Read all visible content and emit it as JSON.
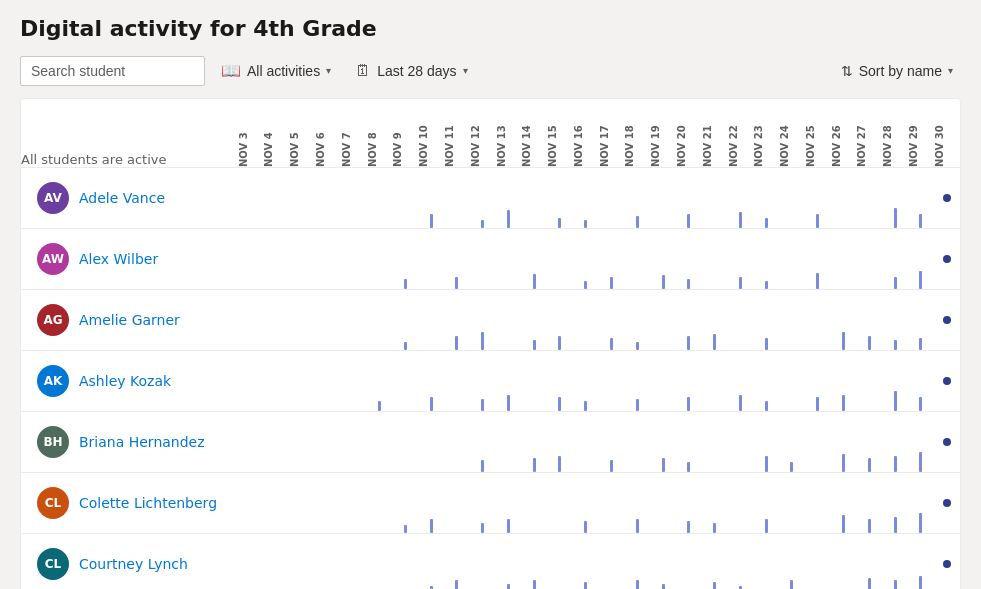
{
  "page": {
    "title": "Digital activity for 4th Grade"
  },
  "toolbar": {
    "search_placeholder": "Search student",
    "activities_label": "All activities",
    "date_range_label": "Last 28 days",
    "sort_label": "Sort by name"
  },
  "table": {
    "header_label": "All students are active",
    "dates": [
      "NOV 3",
      "NOV 4",
      "NOV 5",
      "NOV 6",
      "NOV 7",
      "NOV 8",
      "NOV 9",
      "NOV 10",
      "NOV 11",
      "NOV 12",
      "NOV 13",
      "NOV 14",
      "NOV 15",
      "NOV 16",
      "NOV 17",
      "NOV 18",
      "NOV 19",
      "NOV 20",
      "NOV 21",
      "NOV 22",
      "NOV 23",
      "NOV 24",
      "NOV 25",
      "NOV 26",
      "NOV 27",
      "NOV 28",
      "NOV 29",
      "NOV 30"
    ],
    "students": [
      {
        "initials": "AV",
        "name": "Adele Vance",
        "color": "#6b3fa0"
      },
      {
        "initials": "AW",
        "name": "Alex Wilber",
        "color": "#b0399e"
      },
      {
        "initials": "AG",
        "name": "Amelie Garner",
        "color": "#a4262c"
      },
      {
        "initials": "AK",
        "name": "Ashley Kozak",
        "color": "#0078d4"
      },
      {
        "initials": "BH",
        "name": "Briana Hernandez",
        "color": "#4f6b5e"
      },
      {
        "initials": "CL",
        "name": "Colette Lichtenberg",
        "color": "#ca5010"
      },
      {
        "initials": "CL",
        "name": "Courtney Lynch",
        "color": "#0a6877"
      }
    ]
  }
}
